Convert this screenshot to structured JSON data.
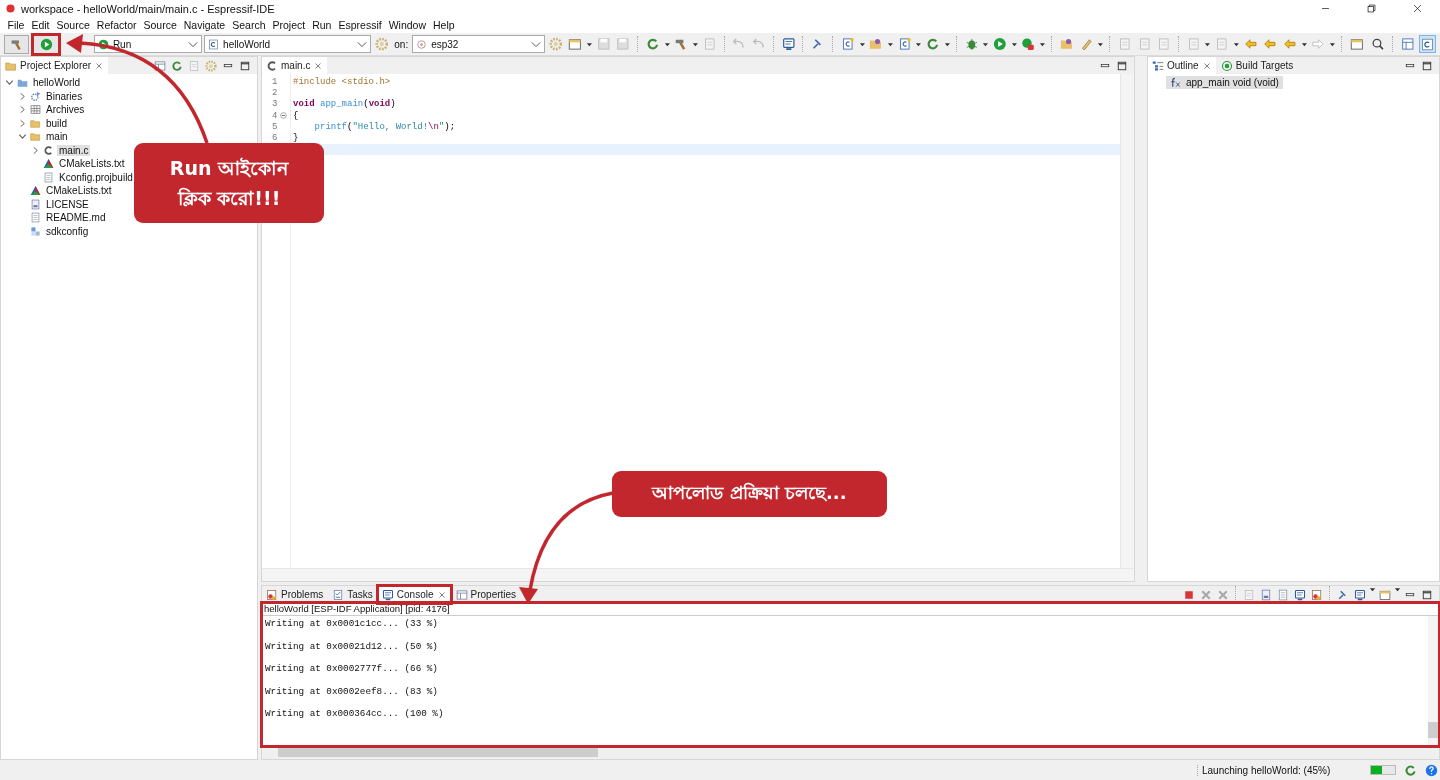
{
  "window": {
    "title": "workspace - helloWorld/main/main.c - Espressif-IDE"
  },
  "menu": [
    "File",
    "Edit",
    "Source",
    "Refactor",
    "Source",
    "Navigate",
    "Search",
    "Project",
    "Run",
    "Espressif",
    "Window",
    "Help"
  ],
  "toolbar": {
    "launch_mode": "Run",
    "launch_config": "helloWorld",
    "target_label": "on:",
    "target": "esp32"
  },
  "project_explorer": {
    "tab": {
      "label": "Project Explorer",
      "selected": true
    },
    "tree": [
      {
        "label": "helloWorld",
        "kind": "project",
        "expanded": true,
        "selected": false,
        "children": [
          {
            "label": "Binaries",
            "kind": "binaries",
            "expanded": false,
            "selected": false
          },
          {
            "label": "Archives",
            "kind": "archives",
            "expanded": false,
            "selected": false
          },
          {
            "label": "build",
            "kind": "folder",
            "expanded": false,
            "selected": false
          },
          {
            "label": "main",
            "kind": "folder",
            "expanded": true,
            "selected": false,
            "children": [
              {
                "label": "main.c",
                "kind": "c-source",
                "expanded": false,
                "selected": true
              },
              {
                "label": "CMakeLists.txt",
                "kind": "cmake",
                "selected": false
              },
              {
                "label": "Kconfig.projbuild",
                "kind": "file",
                "selected": false
              }
            ]
          },
          {
            "label": "CMakeLists.txt",
            "kind": "cmake",
            "selected": false
          },
          {
            "label": "LICENSE",
            "kind": "license",
            "selected": false
          },
          {
            "label": "README.md",
            "kind": "file",
            "selected": false
          },
          {
            "label": "sdkconfig",
            "kind": "config",
            "selected": false
          }
        ]
      }
    ]
  },
  "editor": {
    "tabs": [
      {
        "label": "main.c",
        "selected": true
      }
    ],
    "lines": [
      {
        "number": "1",
        "foldable": false,
        "segments": [
          {
            "kind": "directive",
            "text": "#include <stdio.h>"
          }
        ]
      },
      {
        "number": "2",
        "foldable": false
      },
      {
        "number": "3",
        "foldable": false,
        "segments": [
          {
            "kind": "keyword",
            "text": "void"
          },
          {
            "kind": "function",
            "text": " app_main"
          },
          {
            "kind": "plain",
            "text": "("
          },
          {
            "kind": "keyword",
            "text": "void"
          },
          {
            "kind": "plain",
            "text": ")"
          }
        ]
      },
      {
        "number": "4",
        "foldable": true,
        "segments": [
          {
            "kind": "plain",
            "text": "{"
          }
        ]
      },
      {
        "number": "5",
        "foldable": false,
        "segments": [
          {
            "kind": "function",
            "text": "    printf"
          },
          {
            "kind": "plain",
            "text": "("
          },
          {
            "kind": "string",
            "text": "\"Hello, World!"
          },
          {
            "kind": "escape",
            "text": "\\n"
          },
          {
            "kind": "string",
            "text": "\""
          },
          {
            "kind": "plain",
            "text": ");"
          }
        ]
      },
      {
        "number": "6",
        "foldable": false,
        "segments": [
          {
            "kind": "plain",
            "text": "}"
          }
        ]
      }
    ]
  },
  "outline": {
    "tabs": [
      {
        "label": "Outline",
        "kind": "outline",
        "selected": true
      },
      {
        "label": "Build Targets",
        "kind": "build-targets",
        "selected": false
      }
    ],
    "items": [
      {
        "label": "app_main void (void)",
        "selected": true
      }
    ]
  },
  "bottom_panel": {
    "tabs": [
      {
        "label": "Problems",
        "kind": "problems",
        "selected": false
      },
      {
        "label": "Tasks",
        "kind": "tasks",
        "selected": false
      },
      {
        "label": "Console",
        "kind": "console",
        "selected": true
      },
      {
        "label": "Properties",
        "kind": "properties",
        "selected": false
      }
    ],
    "console": {
      "header": "helloWorld [ESP-IDF Application]  [pid: 4176]",
      "lines": [
        "Writing at 0x0001c1cc... (33 %)",
        "Writing at 0x00021d12... (50 %)",
        "Writing at 0x0002777f... (66 %)",
        "Writing at 0x0002eef8... (83 %)",
        "Writing at 0x000364cc... (100 %)"
      ]
    }
  },
  "status_bar": {
    "message": "Launching helloWorld: (45%)",
    "progress": {
      "level": 0.45
    }
  },
  "annotations": {
    "callouts": [
      {
        "lines": [
          "Run আইকোন",
          "ক্লিক করো!!!"
        ]
      },
      {
        "lines": [
          "আপলোড প্রক্রিয়া চলছে..."
        ]
      }
    ]
  }
}
